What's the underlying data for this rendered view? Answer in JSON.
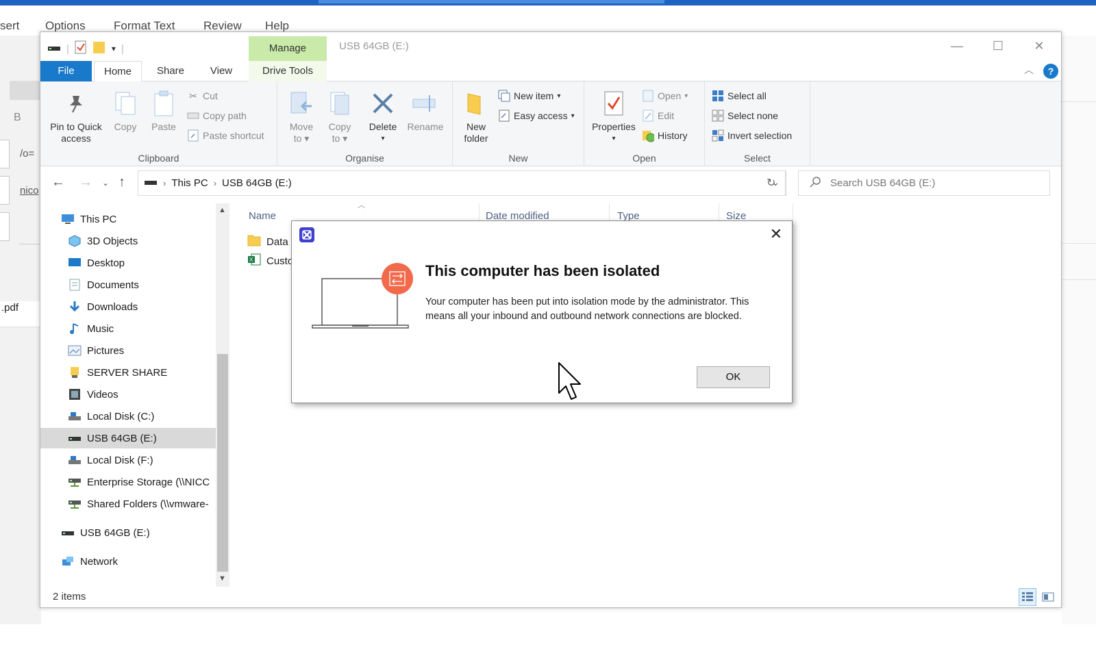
{
  "background_app": {
    "menu": [
      "sert",
      "Options",
      "Format Text",
      "Review",
      "Help"
    ],
    "bold_button": "B",
    "fragments": [
      "/o=",
      "nico"
    ],
    "pdf_fragment": ".pdf"
  },
  "window": {
    "title": "USB 64GB (E:)",
    "context_tab": "Manage",
    "tabs": {
      "file": "File",
      "home": "Home",
      "share": "Share",
      "view": "View",
      "drive_tools": "Drive Tools"
    }
  },
  "ribbon": {
    "clipboard": {
      "label": "Clipboard",
      "pin_line1": "Pin to Quick",
      "pin_line2": "access",
      "copy": "Copy",
      "paste": "Paste",
      "cut": "Cut",
      "copy_path": "Copy path",
      "paste_shortcut": "Paste shortcut"
    },
    "organise": {
      "label": "Organise",
      "move_line1": "Move",
      "move_line2": "to",
      "copy_line1": "Copy",
      "copy_line2": "to",
      "delete": "Delete",
      "rename": "Rename"
    },
    "new": {
      "label": "New",
      "new_folder_line1": "New",
      "new_folder_line2": "folder",
      "new_item": "New item",
      "easy_access": "Easy access"
    },
    "open": {
      "label": "Open",
      "properties": "Properties",
      "open": "Open",
      "edit": "Edit",
      "history": "History"
    },
    "select": {
      "label": "Select",
      "select_all": "Select all",
      "select_none": "Select none",
      "invert_selection": "Invert selection"
    }
  },
  "address": {
    "crumbs": [
      "This PC",
      "USB 64GB (E:)"
    ],
    "search_placeholder": "Search USB 64GB (E:)"
  },
  "nav_pane": {
    "items": [
      {
        "label": "This PC",
        "icon": "pc-icon"
      },
      {
        "label": "3D Objects",
        "icon": "3d-objects-icon"
      },
      {
        "label": "Desktop",
        "icon": "desktop-icon"
      },
      {
        "label": "Documents",
        "icon": "documents-icon"
      },
      {
        "label": "Downloads",
        "icon": "downloads-icon"
      },
      {
        "label": "Music",
        "icon": "music-icon"
      },
      {
        "label": "Pictures",
        "icon": "pictures-icon"
      },
      {
        "label": "SERVER SHARE",
        "icon": "server-share-icon"
      },
      {
        "label": "Videos",
        "icon": "videos-icon"
      },
      {
        "label": "Local Disk (C:)",
        "icon": "local-disk-icon"
      },
      {
        "label": "USB 64GB (E:)",
        "icon": "usb-drive-icon",
        "selected": true
      },
      {
        "label": "Local Disk (F:)",
        "icon": "local-disk-icon"
      },
      {
        "label": "Enterprise Storage (\\\\NICC",
        "icon": "network-drive-icon"
      },
      {
        "label": "Shared Folders (\\\\vmware-",
        "icon": "network-drive-icon"
      },
      {
        "label": "USB 64GB (E:)",
        "icon": "usb-drive-icon"
      },
      {
        "label": "Network",
        "icon": "network-icon"
      }
    ]
  },
  "file_list": {
    "columns": [
      "Name",
      "Date modified",
      "Type",
      "Size"
    ],
    "rows": [
      {
        "name": "Data",
        "icon": "folder-icon"
      },
      {
        "name": "Custo",
        "icon": "excel-file-icon"
      }
    ]
  },
  "status": {
    "item_count": "2 items"
  },
  "dialog": {
    "title": "This computer has been isolated",
    "message": "Your computer has been put into isolation mode by the administrator. This means all your inbound and outbound network connections are blocked.",
    "ok_label": "OK",
    "close_symbol": "✕"
  },
  "colors": {
    "accent": "#1979ca",
    "manage_tab": "#c9eaa8",
    "isolation_badge": "#f26a4b",
    "app_icon": "#3f3fd0"
  }
}
